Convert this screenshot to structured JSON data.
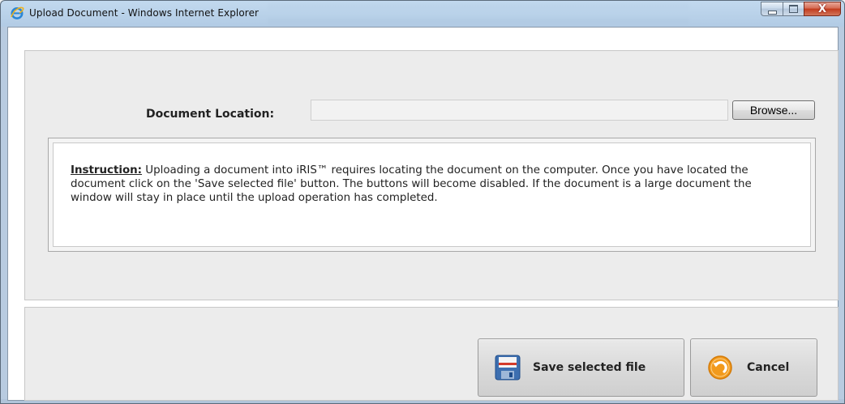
{
  "window": {
    "title": "Upload Document - Windows Internet Explorer",
    "icon": "internet-explorer-icon",
    "close_glyph": "X"
  },
  "form": {
    "document_location_label": "Document Location:",
    "document_location_value": "",
    "browse_label": "Browse..."
  },
  "instruction": {
    "heading": "Instruction:",
    "text": " Uploading a document into iRIS™ requires locating the document on the computer. Once you have located the document click on the 'Save selected file' button. The buttons will become disabled. If the document is a large document the window will stay in place until the upload operation has completed."
  },
  "actions": {
    "save_label": "Save selected file",
    "save_icon": "floppy-disk-icon",
    "cancel_label": "Cancel",
    "cancel_icon": "undo-arrow-icon"
  },
  "colors": {
    "accent_orange": "#f29a1c",
    "floppy_blue": "#3d6fb0",
    "close_red": "#c23b1c"
  }
}
